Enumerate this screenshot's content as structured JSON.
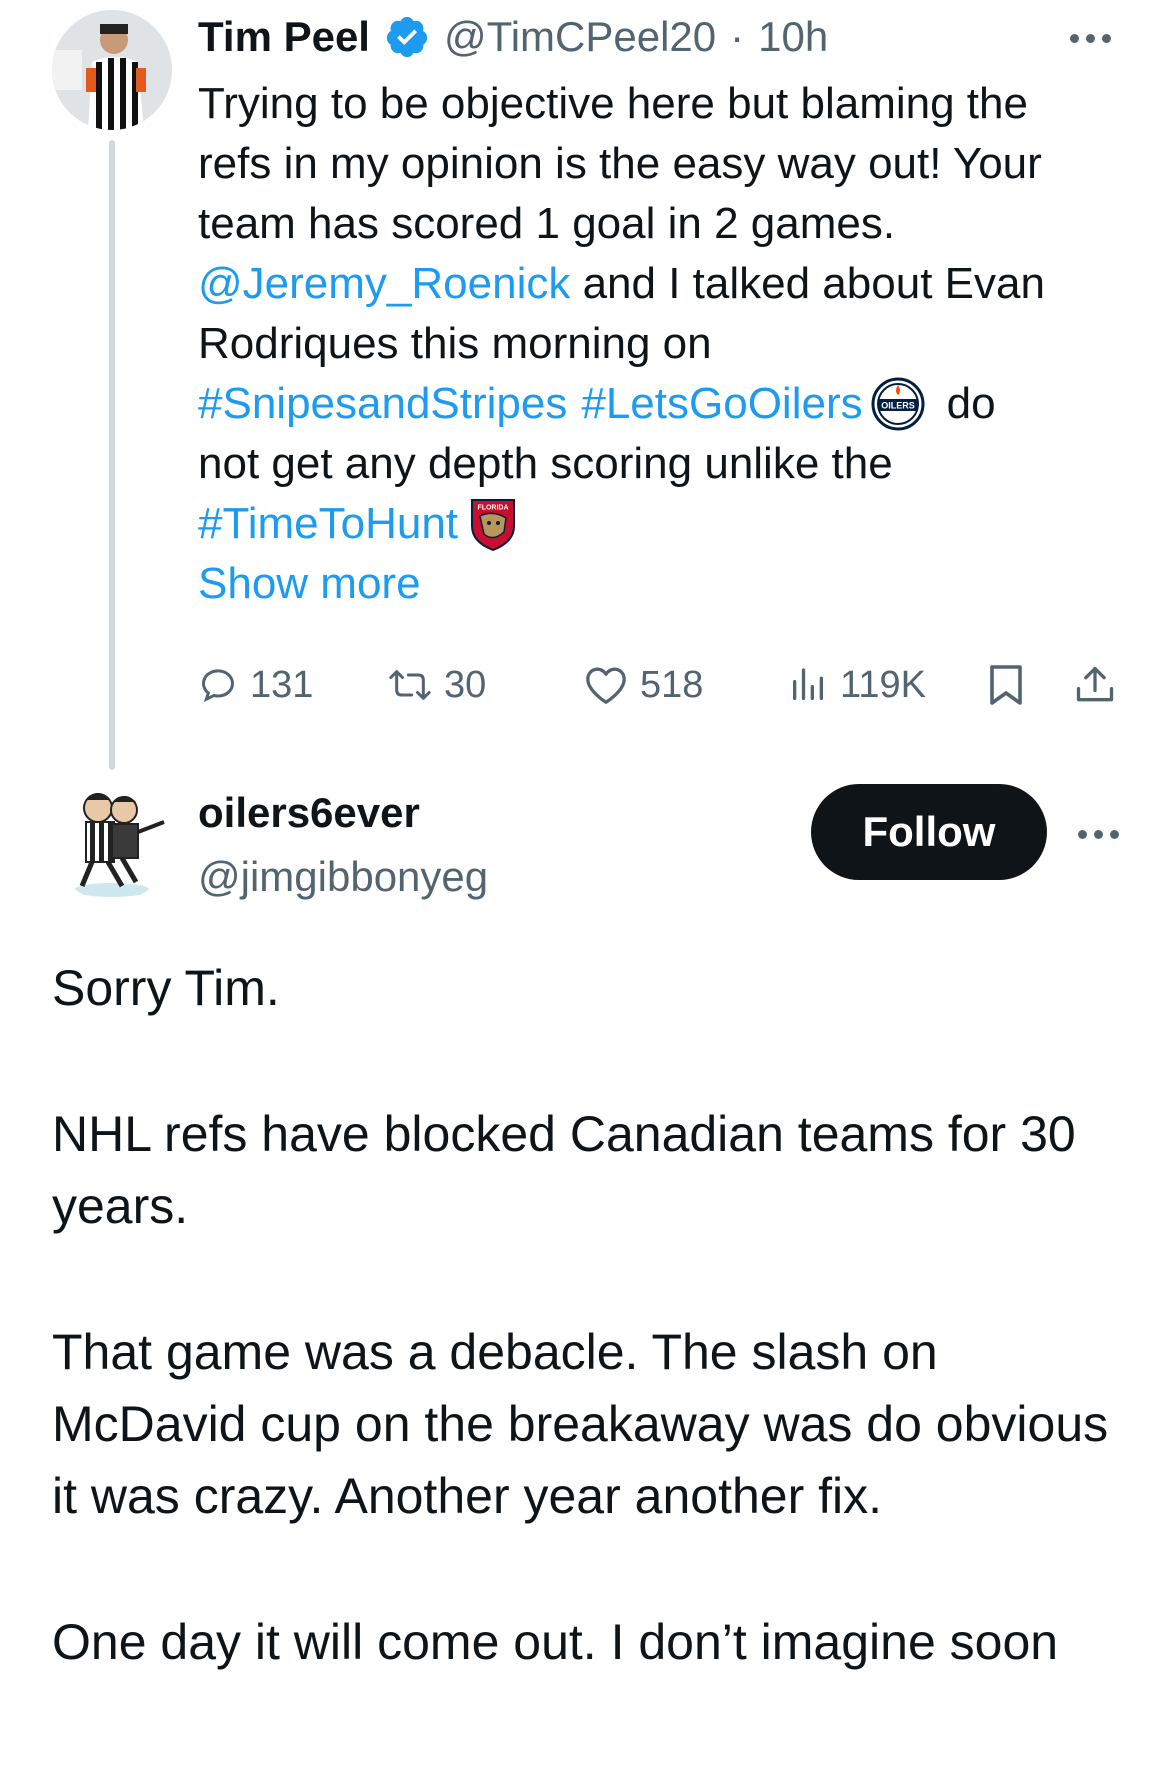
{
  "tweet": {
    "author_name": "Tim Peel",
    "author_handle": "@TimCPeel20",
    "separator": "·",
    "time": "10h",
    "text": {
      "line1": "Trying to be objective here but blaming the",
      "line2": "refs in my opinion is the easy way out! Your",
      "line3": "team has scored 1 goal in 2 games.",
      "mention": "@Jeremy_Roenick",
      "line4_rest": " and I talked about Evan",
      "line5": "Rodriques this morning on",
      "hashtag1": "#SnipesandStripes",
      "hashtag2": "#LetsGoOilers",
      "line6_rest": "do",
      "line7": "not get any depth scoring unlike the",
      "hashtag3": "#TimeToHunt"
    },
    "show_more": "Show more",
    "stats": {
      "replies": "131",
      "retweets": "30",
      "likes": "518",
      "views": "119K"
    },
    "emoji": {
      "oilers_logo_text": "OILERS",
      "panthers_logo_text": "FLORIDA"
    }
  },
  "reply": {
    "author_name": "oilers6ever",
    "author_handle": "@jimgibbonyeg",
    "follow_label": "Follow",
    "paragraphs": [
      "Sorry Tim.",
      "NHL refs have blocked Canadian teams for 30 years.",
      "That game was a debacle.  The slash on McDavid cup on the breakaway was do obvious it was crazy. Another year another fix.",
      "One day it will come out. I don’t imagine soon"
    ]
  },
  "icons": [
    "verified-badge-icon",
    "more-icon",
    "reply-icon",
    "retweet-icon",
    "like-icon",
    "views-icon",
    "bookmark-icon",
    "share-icon"
  ],
  "colors": {
    "link": "#1d9bf0",
    "muted": "#536471",
    "text": "#0f1419",
    "follow_button": "#0f1419",
    "thread_line": "#cfd9de"
  }
}
